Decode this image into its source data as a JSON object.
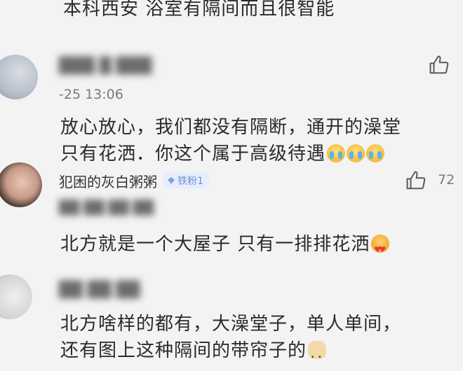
{
  "comments": [
    {
      "content": "本科西安 浴室有隔间而且很智能"
    },
    {
      "username": "███ █ ███",
      "time": "-25 13:06",
      "content_line1": "放心放心，我们都没有隔断，通开的澡堂",
      "content_line2": "只有花洒．你这个属于高级待遇"
    },
    {
      "username": "犯困的灰白粥粥",
      "badge": "铁粉1",
      "like_count": "72",
      "time": "██ ██ ██ ██",
      "content": "北方就是一个大屋子 只有一排排花洒"
    },
    {
      "username": "██ ██ ██",
      "content_line1": "北方啥样的都有，大澡堂子，单人单间，",
      "content_line2": "还有图上这种隔间的带帘子的"
    }
  ],
  "icons": {
    "like": "thumbs-up-icon",
    "badge": "diamond-icon",
    "emoji_cry": "crying-face-emoji",
    "emoji_heart": "heart-eyes-emoji",
    "emoji_dog": "doge-emoji"
  },
  "colors": {
    "background": "#f3f3f4",
    "text": "#2a2a2a",
    "meta": "#7a7a7a",
    "badge_bg": "#e7eefb",
    "badge_text": "#6b8fd6"
  }
}
